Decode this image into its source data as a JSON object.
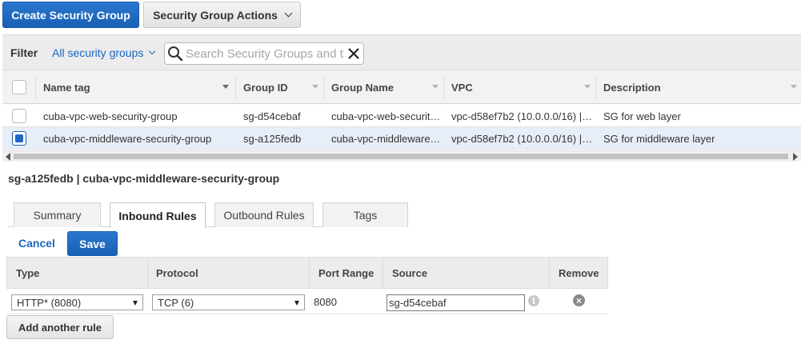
{
  "toolbar": {
    "create_label": "Create Security Group",
    "actions_label": "Security Group Actions"
  },
  "filter": {
    "label": "Filter",
    "scope": "All security groups",
    "search_placeholder": "Search Security Groups and their properties"
  },
  "table": {
    "columns": [
      "Name tag",
      "Group ID",
      "Group Name",
      "VPC",
      "Description"
    ],
    "rows": [
      {
        "name_tag": "cuba-vpc-web-security-group",
        "group_id": "sg-d54cebaf",
        "group_name": "cuba-vpc-web-securit…",
        "vpc": "vpc-d58ef7b2 (10.0.0.0/16) |…",
        "description": "SG for web layer",
        "selected": false
      },
      {
        "name_tag": "cuba-vpc-middleware-security-group",
        "group_id": "sg-a125fedb",
        "group_name": "cuba-vpc-middleware…",
        "vpc": "vpc-d58ef7b2 (10.0.0.0/16) |…",
        "description": "SG for middleware layer",
        "selected": true
      }
    ]
  },
  "detail": {
    "title": "sg-a125fedb | cuba-vpc-middleware-security-group",
    "tabs": [
      "Summary",
      "Inbound Rules",
      "Outbound Rules",
      "Tags"
    ],
    "active_tab": "Inbound Rules",
    "cancel_label": "Cancel",
    "save_label": "Save",
    "rules_columns": [
      "Type",
      "Protocol",
      "Port Range",
      "Source",
      "Remove"
    ],
    "rules": [
      {
        "type": "HTTP* (8080)",
        "protocol": "TCP (6)",
        "port_range": "8080",
        "source": "sg-d54cebaf"
      }
    ],
    "add_rule_label": "Add another rule"
  },
  "colors": {
    "primary": "#1a66c2",
    "selected_row": "#e8eef8"
  }
}
